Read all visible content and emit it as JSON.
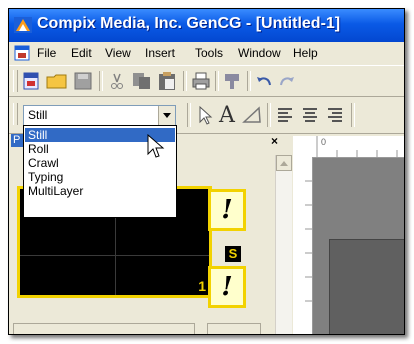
{
  "window": {
    "title": "Compix Media, Inc. GenCG - [Untitled-1]"
  },
  "menu": {
    "items": [
      "File",
      "Edit",
      "View",
      "Insert",
      "Tools",
      "Window",
      "Help"
    ]
  },
  "toolbar2": {
    "mode_select": {
      "value": "Still",
      "options": [
        "Still",
        "Roll",
        "Crawl",
        "Typing",
        "MultiLayer"
      ],
      "highlighted": "Still"
    },
    "text_tool_label": "A"
  },
  "panel": {
    "title_fragment": "P",
    "close_label": "×",
    "page_number": "1",
    "badge": "S",
    "bang": "!"
  },
  "ruler": {
    "label_0": "0"
  },
  "colors": {
    "accent": "#316ac5",
    "highlight": "#f2d200",
    "titlebar": "#0a5ae6"
  }
}
